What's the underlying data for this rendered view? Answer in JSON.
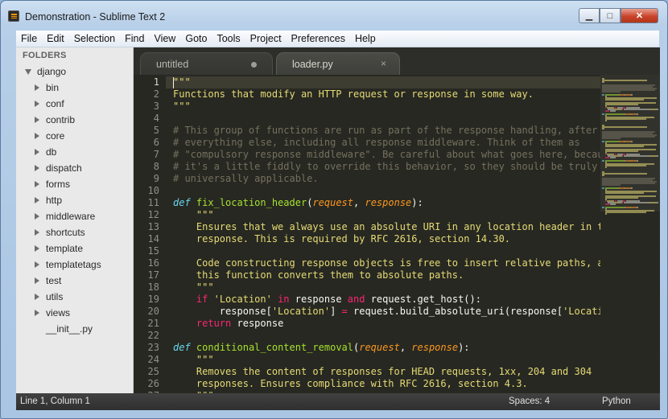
{
  "window": {
    "title": "Demonstration - Sublime Text 2",
    "minimize_glyph": "▁",
    "maximize_glyph": "□",
    "close_glyph": "✕"
  },
  "menu": [
    "File",
    "Edit",
    "Selection",
    "Find",
    "View",
    "Goto",
    "Tools",
    "Project",
    "Preferences",
    "Help"
  ],
  "sidebar": {
    "heading": "FOLDERS",
    "root": "django",
    "items": [
      "bin",
      "conf",
      "contrib",
      "core",
      "db",
      "dispatch",
      "forms",
      "http",
      "middleware",
      "shortcuts",
      "template",
      "templatetags",
      "test",
      "utils",
      "views"
    ],
    "file": "__init__.py"
  },
  "tabs": [
    {
      "label": "untitled",
      "state": "dirty"
    },
    {
      "label": "loader.py",
      "state": "active",
      "close_glyph": "×"
    }
  ],
  "editor": {
    "current_line": 1,
    "line_numbers": [
      "1",
      "2",
      "3",
      "4",
      "5",
      "6",
      "7",
      "8",
      "9",
      "10",
      "11",
      "12",
      "13",
      "14",
      "15",
      "16",
      "17",
      "18",
      "19",
      "20",
      "21",
      "22",
      "23",
      "24",
      "25",
      "26",
      "27"
    ],
    "lines": [
      [
        {
          "t": "\"\"\"",
          "c": "s"
        }
      ],
      [
        {
          "t": "Functions that modify an HTTP request or response in some way.",
          "c": "s"
        }
      ],
      [
        {
          "t": "\"\"\"",
          "c": "s"
        }
      ],
      [],
      [
        {
          "t": "# This group of functions are run as part of the response handling, after",
          "c": "c"
        }
      ],
      [
        {
          "t": "# everything else, including all response middleware. Think of them as",
          "c": "c"
        }
      ],
      [
        {
          "t": "# \"compulsory response middleware\". Be careful about what goes here, because",
          "c": "c"
        }
      ],
      [
        {
          "t": "# it's a little fiddly to override this behavior, so they should be truly",
          "c": "c"
        }
      ],
      [
        {
          "t": "# universally applicable.",
          "c": "c"
        }
      ],
      [],
      [
        {
          "t": "def",
          "c": "k"
        },
        {
          "t": " ",
          "c": ""
        },
        {
          "t": "fix_location_header",
          "c": "f"
        },
        {
          "t": "(",
          "c": ""
        },
        {
          "t": "request",
          "c": "p"
        },
        {
          "t": ", ",
          "c": ""
        },
        {
          "t": "response",
          "c": "p"
        },
        {
          "t": "):",
          "c": ""
        }
      ],
      [
        {
          "t": "    \"\"\"",
          "c": "s"
        }
      ],
      [
        {
          "t": "    Ensures that we always use an absolute URI in any location header in the",
          "c": "s"
        }
      ],
      [
        {
          "t": "    response. This is required by RFC 2616, section 14.30.",
          "c": "s"
        }
      ],
      [],
      [
        {
          "t": "    Code constructing response objects is free to insert relative paths, as",
          "c": "s"
        }
      ],
      [
        {
          "t": "    this function converts them to absolute paths.",
          "c": "s"
        }
      ],
      [
        {
          "t": "    \"\"\"",
          "c": "s"
        }
      ],
      [
        {
          "t": "    ",
          "c": ""
        },
        {
          "t": "if",
          "c": "kw"
        },
        {
          "t": " ",
          "c": ""
        },
        {
          "t": "'Location'",
          "c": "s"
        },
        {
          "t": " ",
          "c": ""
        },
        {
          "t": "in",
          "c": "kw"
        },
        {
          "t": " response ",
          "c": ""
        },
        {
          "t": "and",
          "c": "kw"
        },
        {
          "t": " request.get_host():",
          "c": ""
        }
      ],
      [
        {
          "t": "        response[",
          "c": ""
        },
        {
          "t": "'Location'",
          "c": "s"
        },
        {
          "t": "] ",
          "c": ""
        },
        {
          "t": "=",
          "c": "kw"
        },
        {
          "t": " request.build_absolute_uri(response[",
          "c": ""
        },
        {
          "t": "'Location'",
          "c": "s"
        },
        {
          "t": "])",
          "c": ""
        }
      ],
      [
        {
          "t": "    ",
          "c": ""
        },
        {
          "t": "return",
          "c": "kw"
        },
        {
          "t": " response",
          "c": ""
        }
      ],
      [],
      [
        {
          "t": "def",
          "c": "k"
        },
        {
          "t": " ",
          "c": ""
        },
        {
          "t": "conditional_content_removal",
          "c": "f"
        },
        {
          "t": "(",
          "c": ""
        },
        {
          "t": "request",
          "c": "p"
        },
        {
          "t": ", ",
          "c": ""
        },
        {
          "t": "response",
          "c": "p"
        },
        {
          "t": "):",
          "c": ""
        }
      ],
      [
        {
          "t": "    \"\"\"",
          "c": "s"
        }
      ],
      [
        {
          "t": "    Removes the content of responses for HEAD requests, 1xx, 204 and 304",
          "c": "s"
        }
      ],
      [
        {
          "t": "    responses. Ensures compliance with RFC 2616, section 4.3.",
          "c": "s"
        }
      ],
      [
        {
          "t": "    \"\"\"",
          "c": "s"
        }
      ]
    ]
  },
  "status": {
    "position": "Line 1, Column 1",
    "spaces": "Spaces: 4",
    "syntax": "Python"
  },
  "colors": {
    "editor_bg": "#272822",
    "string": "#e6db74",
    "comment": "#75715e",
    "storage": "#66d9ef",
    "function": "#a6e22e",
    "parameter": "#fd971f",
    "keyword": "#f92672"
  }
}
